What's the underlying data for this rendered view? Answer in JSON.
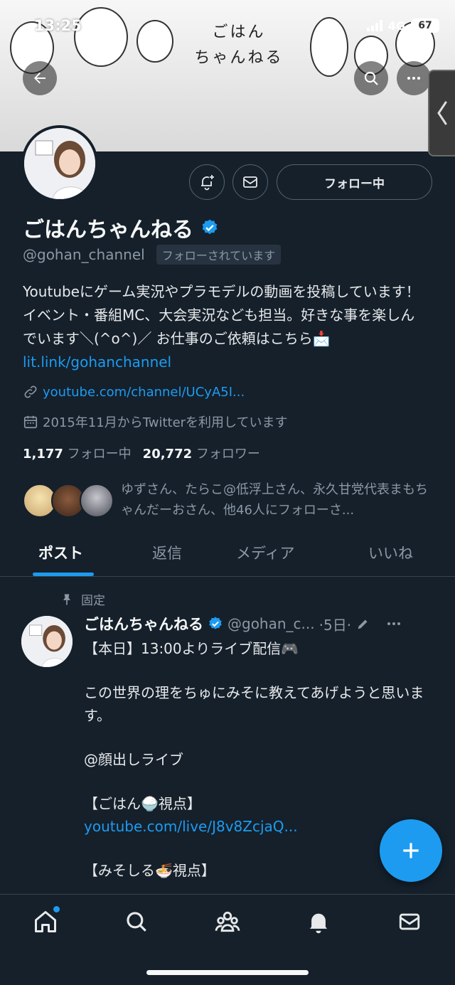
{
  "status_bar": {
    "time": "13:25",
    "network": "4G",
    "battery": "67"
  },
  "banner": {
    "title_line1": "ごはん",
    "title_line2": "ちゃんねる"
  },
  "header_buttons": {
    "back_icon": "arrow-left-icon",
    "search_icon": "search-icon",
    "more_icon": "more-icon"
  },
  "profile": {
    "name": "ごはんちゃんねる",
    "handle": "@gohan_channel",
    "follows_you": "フォローされています",
    "follow_button": "フォロー中",
    "bio_text": "Youtubeにゲーム実況やプラモデルの動画を投稿しています！ イベント・番組MC、大会実況なども担当。好きな事を楽しんでいます＼(^o^)／ お仕事のご依頼はこちら📩 ",
    "bio_link": "lit.link/gohanchannel",
    "website": "youtube.com/channel/UCyA5I...",
    "joined": "2015年11月からTwitterを利用しています",
    "following_count": "1,177",
    "following_label": "フォロー中",
    "followers_count": "20,772",
    "followers_label": "フォロワー",
    "known_followers": "ゆずさん、たらこ@低浮上さん、永久甘党代表まもちゃんだーおさん、他46人にフォローさ..."
  },
  "tabs": [
    {
      "label": "ポスト",
      "active": true
    },
    {
      "label": "返信",
      "active": false
    },
    {
      "label": "メディア",
      "active": false
    },
    {
      "label": "いいね",
      "active": false
    }
  ],
  "tweet": {
    "pinned_label": "固定",
    "name": "ごはんちゃんねる",
    "handle": "@gohan_c...",
    "time": "·5日·",
    "line1": "【本日】13:00よりライブ配信🎮",
    "line2": "この世界の理をちゅにみそに教えてあげようと思います。",
    "line3": "@顔出しライブ",
    "line4": "【ごはん🍚視点】",
    "link1": "youtube.com/live/J8v8ZcjaQ...",
    "line5": "【みそしる🍜視点】"
  },
  "colors": {
    "background": "#15202b",
    "accent": "#1d9bf0",
    "secondary_text": "#8b98a5",
    "border": "#38444d"
  },
  "bottom_nav": [
    "home-icon",
    "search-icon",
    "communities-icon",
    "notifications-icon",
    "messages-icon"
  ]
}
